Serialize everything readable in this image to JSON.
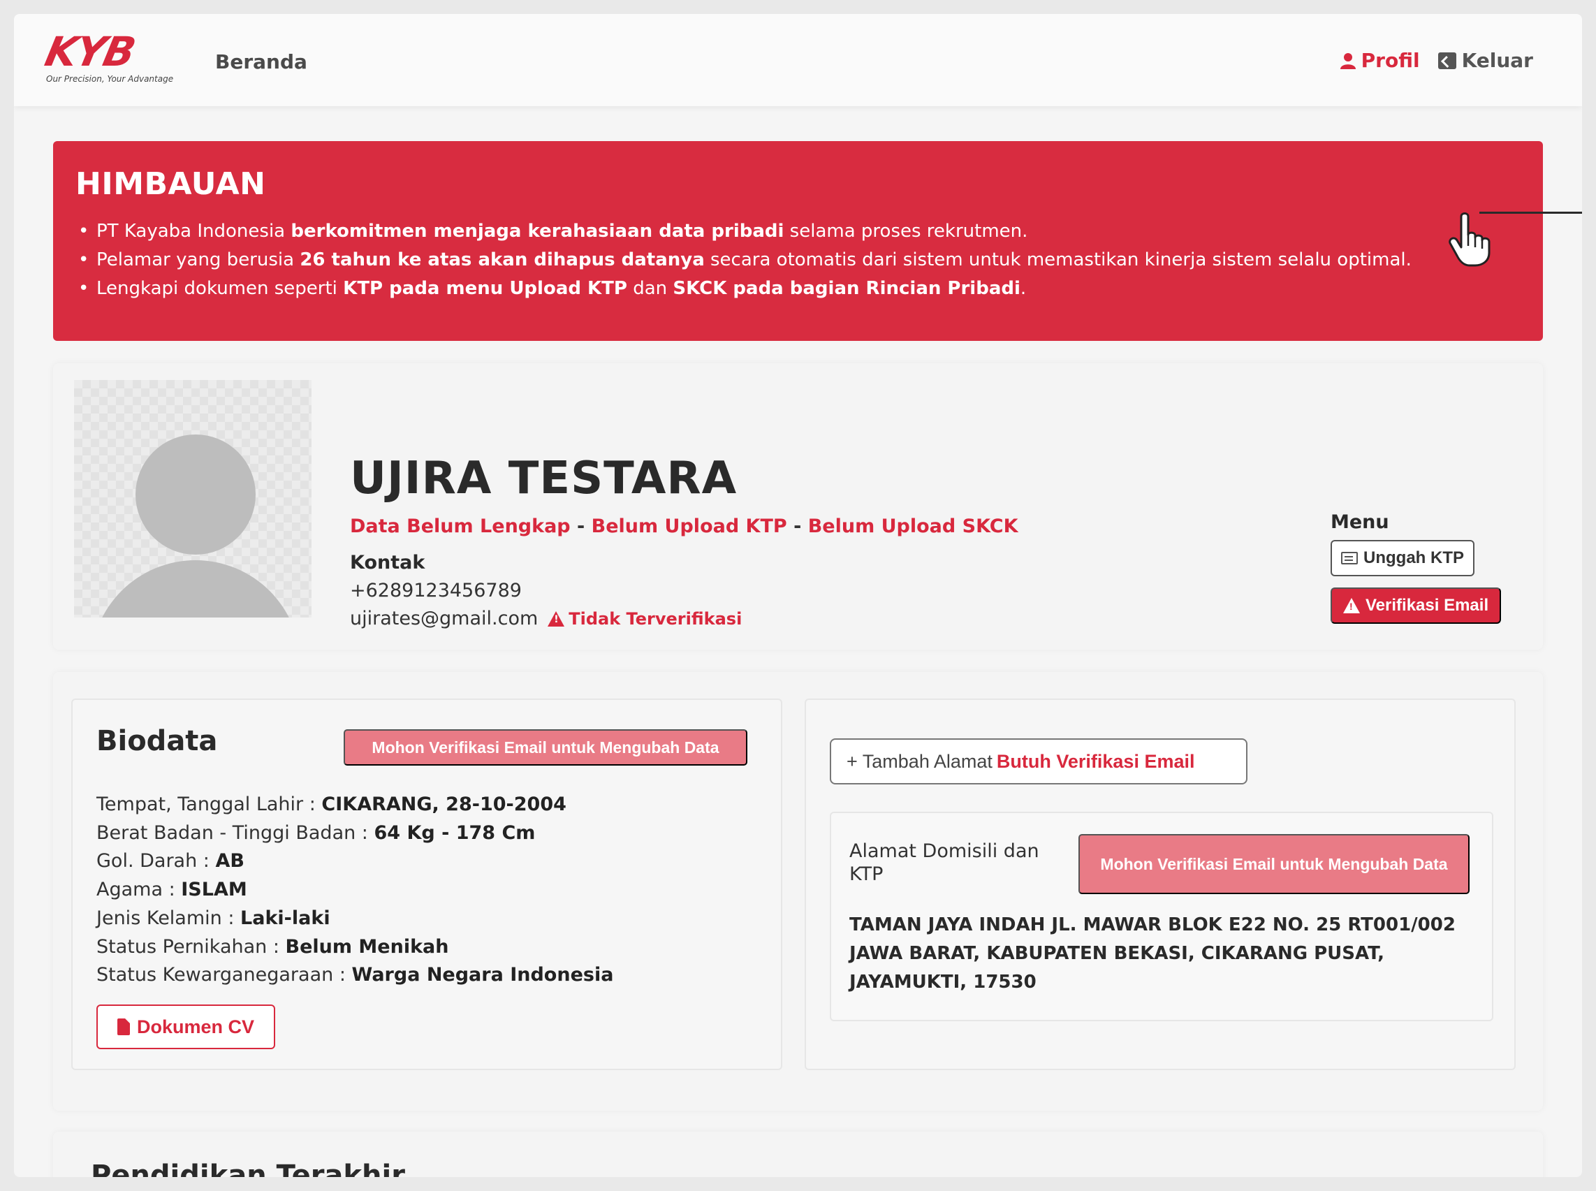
{
  "navbar": {
    "logo_text": "KYB",
    "logo_tagline": "Our Precision, Your Advantage",
    "home_label": "Beranda",
    "profile_label": "Profil",
    "logout_label": "Keluar"
  },
  "alert": {
    "title": "HIMBAUAN",
    "items": [
      {
        "pre": "PT Kayaba Indonesia ",
        "bold1": "berkomitmen menjaga kerahasiaan data pribadi",
        "mid": " selama proses rekrutmen.",
        "bold2": "",
        "post": ""
      },
      {
        "pre": "Pelamar yang berusia ",
        "bold1": "26 tahun ke atas akan dihapus datanya",
        "mid": " secara otomatis dari sistem untuk memastikan kinerja sistem selalu optimal.",
        "bold2": "",
        "post": ""
      },
      {
        "pre": "Lengkapi dokumen seperti ",
        "bold1": "KTP pada menu Upload KTP",
        "mid": " dan ",
        "bold2": "SKCK pada bagian Rincian Pribadi",
        "post": "."
      }
    ]
  },
  "profile": {
    "name": "UJIRA TESTARA",
    "status": [
      "Data Belum Lengkap",
      "Belum Upload KTP",
      "Belum Upload SKCK"
    ],
    "status_separator": " - ",
    "contact_label": "Kontak",
    "phone": "+6289123456789",
    "email": "ujirates@gmail.com",
    "email_status": "Tidak Terverifikasi",
    "menu_label": "Menu",
    "upload_ktp_label": "Unggah KTP",
    "verify_email_label": "Verifikasi Email"
  },
  "biodata": {
    "title": "Biodata",
    "verify_button": "Mohon Verifikasi Email untuk Mengubah Data",
    "rows": [
      {
        "label": "Tempat, Tanggal Lahir : ",
        "value": "CIKARANG, 28-10-2004"
      },
      {
        "label": "Berat Badan - Tinggi Badan : ",
        "value": "64 Kg - 178 Cm"
      },
      {
        "label": "Gol. Darah : ",
        "value": "AB"
      },
      {
        "label": "Agama : ",
        "value": "ISLAM"
      },
      {
        "label": "Jenis Kelamin : ",
        "value": "Laki-laki"
      },
      {
        "label": "Status Pernikahan : ",
        "value": "Belum Menikah"
      },
      {
        "label": "Status Kewarganegaraan : ",
        "value": "Warga Negara Indonesia"
      }
    ],
    "cv_button": "Dokumen CV"
  },
  "address": {
    "add_label": "+ Tambah Alamat",
    "add_needs": "Butuh Verifikasi Email",
    "entry_label": "Alamat Domisili dan KTP",
    "verify_button": "Mohon Verifikasi Email untuk Mengubah Data",
    "line": "TAMAN JAYA INDAH JL. MAWAR BLOK E22 NO. 25 RT001/002 JAWA BARAT, KABUPATEN BEKASI, CIKARANG PUSAT, JAYAMUKTI, 17530"
  },
  "education": {
    "title": "Pendidikan Terakhir"
  }
}
